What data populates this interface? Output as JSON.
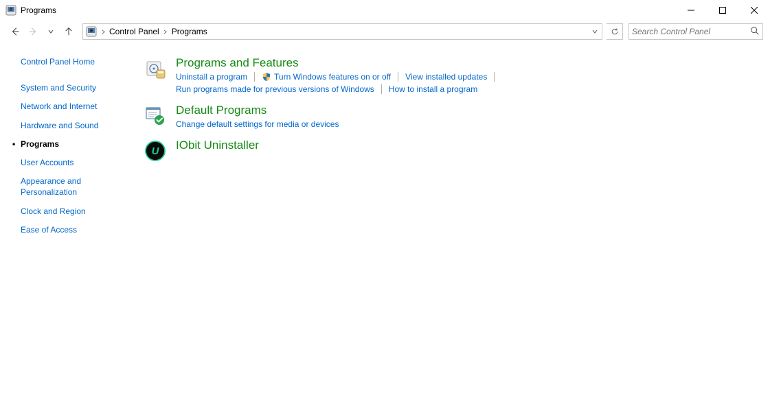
{
  "window": {
    "title": "Programs"
  },
  "breadcrumb": {
    "root": "Control Panel",
    "current": "Programs"
  },
  "search": {
    "placeholder": "Search Control Panel"
  },
  "sidebar": {
    "home": "Control Panel Home",
    "items": [
      "System and Security",
      "Network and Internet",
      "Hardware and Sound",
      "Programs",
      "User Accounts",
      "Appearance and Personalization",
      "Clock and Region",
      "Ease of Access"
    ],
    "active_index": 3
  },
  "categories": [
    {
      "title": "Programs and Features",
      "tasks_row1": [
        {
          "label": "Uninstall a program",
          "shield": false
        },
        {
          "label": "Turn Windows features on or off",
          "shield": true
        },
        {
          "label": "View installed updates",
          "shield": false
        }
      ],
      "tasks_row2": [
        {
          "label": "Run programs made for previous versions of Windows",
          "shield": false
        },
        {
          "label": "How to install a program",
          "shield": false
        }
      ]
    },
    {
      "title": "Default Programs",
      "tasks_row1": [
        {
          "label": "Change default settings for media or devices",
          "shield": false
        }
      ],
      "tasks_row2": []
    },
    {
      "title": "IObit Uninstaller",
      "tasks_row1": [],
      "tasks_row2": []
    }
  ]
}
